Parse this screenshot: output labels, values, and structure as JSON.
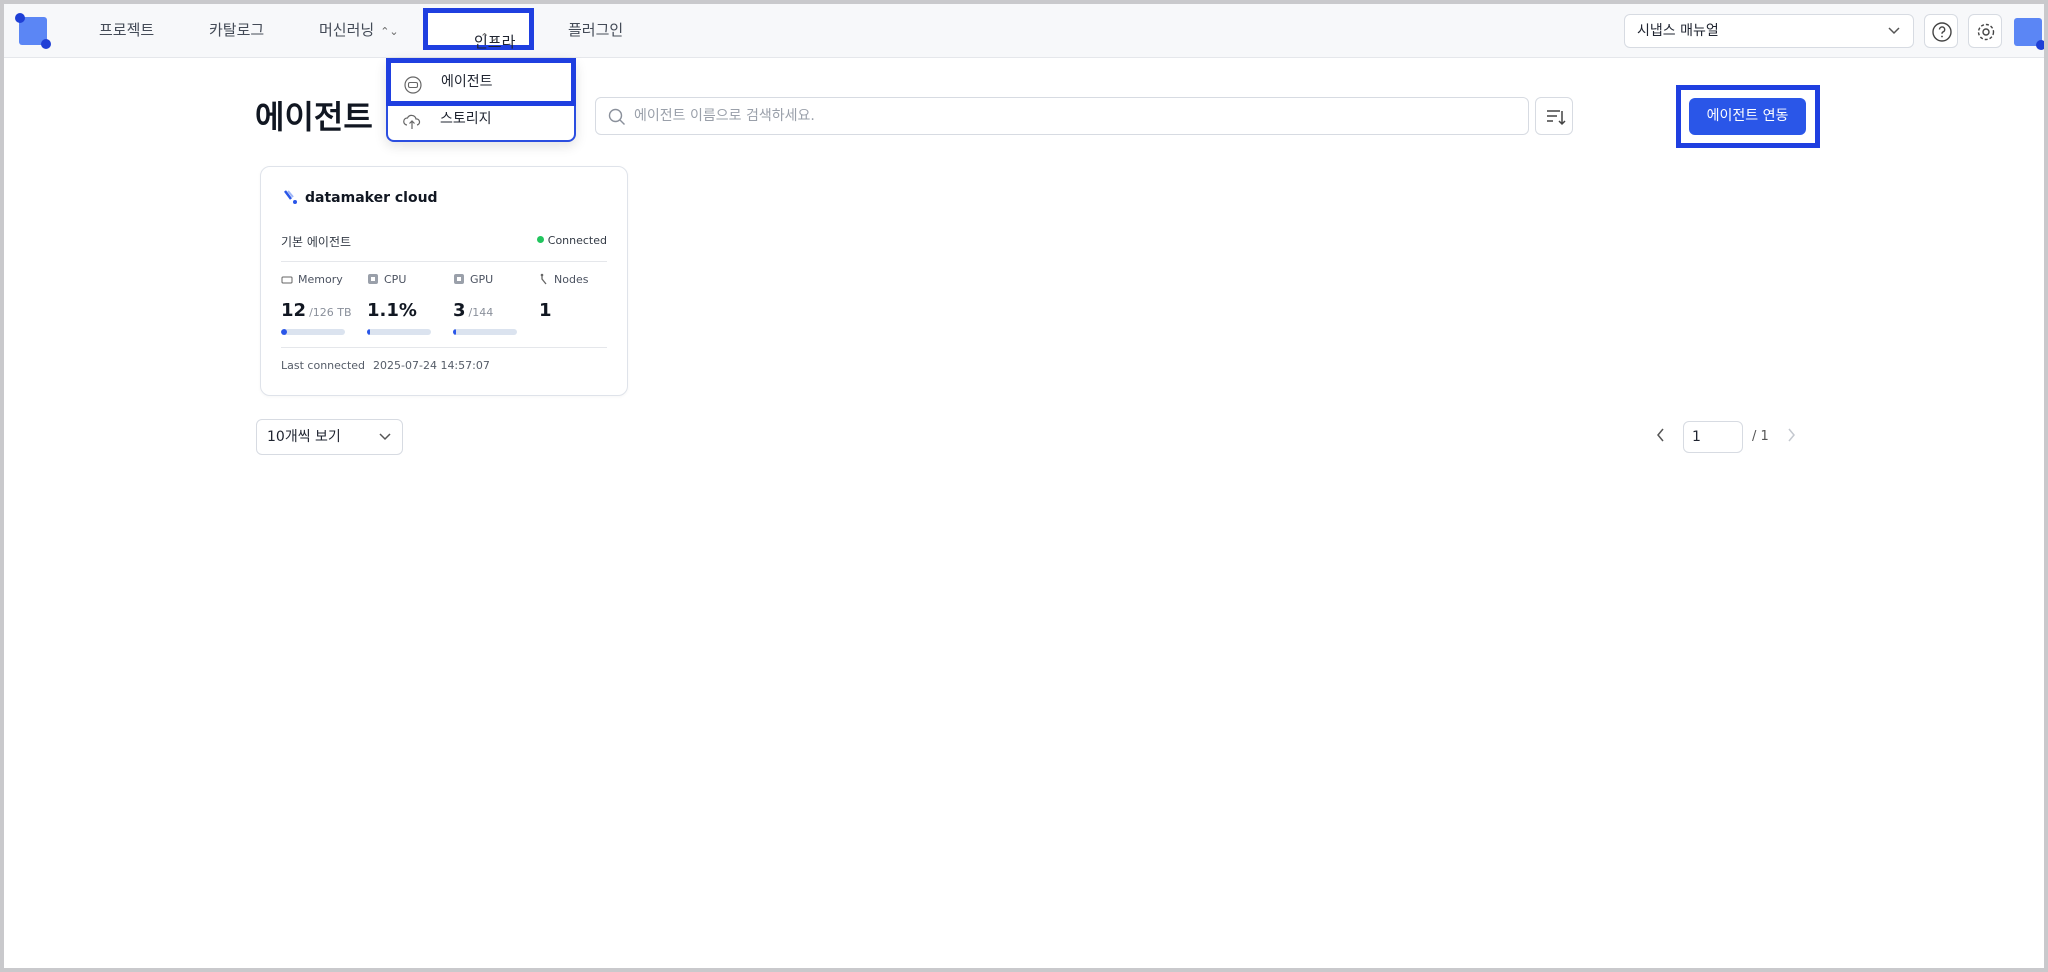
{
  "nav": {
    "items": [
      {
        "label": "프로젝트"
      },
      {
        "label": "카탈로그"
      },
      {
        "label": "머신러닝"
      },
      {
        "label": "인프라"
      },
      {
        "label": "플러그인"
      }
    ],
    "chevron": "⌃⌄"
  },
  "header": {
    "manual_select": "시냅스 매뉴얼",
    "help_icon": "question-circle-icon",
    "settings_icon": "gear-icon"
  },
  "dropdown": {
    "items": [
      {
        "label": "에이전트",
        "icon": "agent-icon"
      },
      {
        "label": "스토리지",
        "icon": "cloud-storage-icon"
      }
    ]
  },
  "page": {
    "title": "에이전트",
    "search_placeholder": "에이전트 이름으로 검색하세요.",
    "connect_button": "에이전트 연동"
  },
  "card": {
    "name": "datamaker cloud",
    "subtitle": "기본 에이전트",
    "status": "Connected",
    "status_color": "#22c55e",
    "metrics": [
      {
        "label": "Memory",
        "value": "12",
        "unit": "/126 TB",
        "fill_fraction": 0.095
      },
      {
        "label": "CPU",
        "value": "1.1%",
        "unit": "",
        "fill_fraction": 0.011
      },
      {
        "label": "GPU",
        "value": "3",
        "unit": "/144",
        "fill_fraction": 0.021
      },
      {
        "label": "Nodes",
        "value": "1",
        "unit": ""
      }
    ],
    "last_connected_label": "Last connected",
    "last_connected_value": "2025-07-24 14:57:07"
  },
  "pagination": {
    "page_size": "10개씩 보기",
    "current_page": "1",
    "total": "/ 1"
  },
  "colors": {
    "accent": "#2a56e8",
    "highlight_border": "#1f3fe0"
  }
}
